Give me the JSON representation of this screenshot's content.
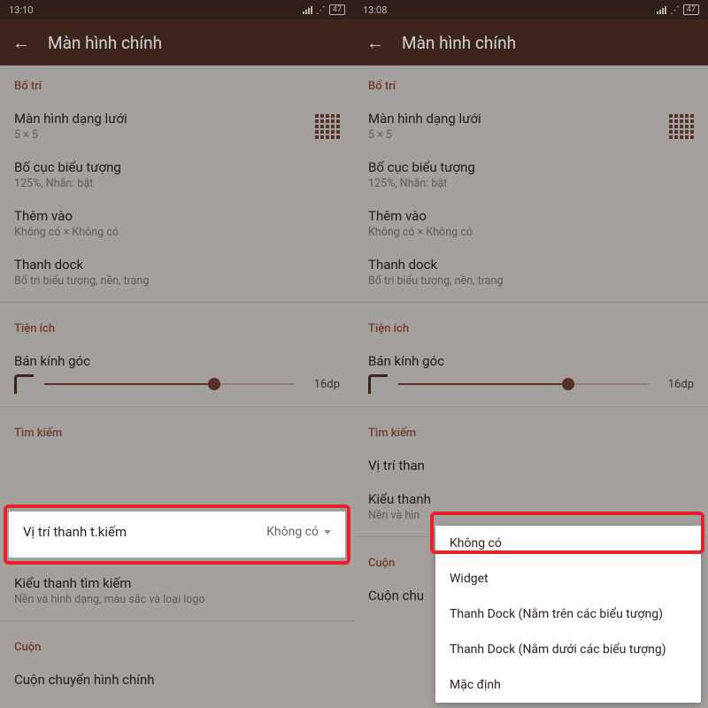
{
  "left": {
    "status": {
      "time": "13:10",
      "battery": "47"
    },
    "appbar": {
      "title": "Màn hình chính"
    },
    "sections": {
      "layout_label": "Bố trí",
      "grid": {
        "title": "Màn hình dạng lưới",
        "sub": "5 × 5"
      },
      "icon_layout": {
        "title": "Bố cục biểu tượng",
        "sub": "125%, Nhãn: bật"
      },
      "add": {
        "title": "Thêm vào",
        "sub": "Không có × Không có"
      },
      "dock": {
        "title": "Thanh dock",
        "sub": "Bố trí biểu tượng, nền, trang"
      },
      "widget_label": "Tiện ích",
      "radius": {
        "title": "Bán kính góc",
        "value": "16dp"
      },
      "search_label": "Tìm kiếm",
      "search_pos": {
        "title": "Vị trí thanh t.kiếm",
        "value": "Không có"
      },
      "search_style": {
        "title": "Kiểu thanh tìm kiếm",
        "sub": "Nền và hình dạng, màu sắc và loại logo"
      },
      "scroll_label": "Cuộn",
      "scroll_item": {
        "title": "Cuộn chuyển hình chính"
      }
    }
  },
  "right": {
    "status": {
      "time": "13:08",
      "battery": "47"
    },
    "appbar": {
      "title": "Màn hình chính"
    },
    "popup": {
      "options": [
        "Không có",
        "Widget",
        "Thanh Dock (Nằm trên các biểu tượng)",
        "Thanh Dock (Nằm dưới các biểu tượng)",
        "Mặc định"
      ]
    },
    "search_pos_title_truncated": "Vị trí than",
    "search_style_title": "Kiểu thanh",
    "search_style_sub": "Nền và hìn",
    "scroll_item_truncated": "Cuộn chu"
  }
}
